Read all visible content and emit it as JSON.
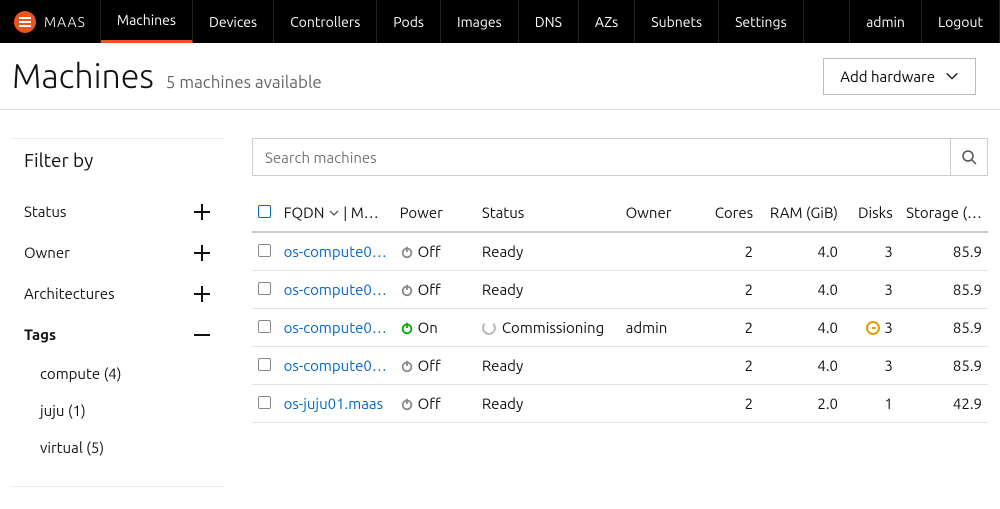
{
  "brand": "MAAS",
  "nav": {
    "items": [
      "Machines",
      "Devices",
      "Controllers",
      "Pods",
      "Images",
      "DNS",
      "AZs",
      "Subnets",
      "Settings"
    ],
    "right": [
      "admin",
      "Logout"
    ],
    "active_index": 0
  },
  "header": {
    "title": "Machines",
    "subtitle": "5 machines available",
    "add_button": "Add hardware"
  },
  "sidebar": {
    "title": "Filter by",
    "filters": [
      {
        "label": "Status",
        "expanded": false
      },
      {
        "label": "Owner",
        "expanded": false
      },
      {
        "label": "Architectures",
        "expanded": false
      },
      {
        "label": "Tags",
        "expanded": true,
        "items": [
          "compute (4)",
          "juju (1)",
          "virtual (5)"
        ]
      }
    ]
  },
  "search": {
    "placeholder": "Search machines"
  },
  "table": {
    "columns": [
      "",
      "FQDN ⌄ | M…",
      "Power",
      "Status",
      "Owner",
      "Cores",
      "RAM (GiB)",
      "Disks",
      "Storage (…"
    ],
    "rows": [
      {
        "fqdn": "os-compute0…",
        "power": "Off",
        "power_on": false,
        "status": "Ready",
        "busy": false,
        "owner": "",
        "cores": "2",
        "ram": "4.0",
        "disks": "3",
        "disks_warn": false,
        "storage": "85.9"
      },
      {
        "fqdn": "os-compute0…",
        "power": "Off",
        "power_on": false,
        "status": "Ready",
        "busy": false,
        "owner": "",
        "cores": "2",
        "ram": "4.0",
        "disks": "3",
        "disks_warn": false,
        "storage": "85.9"
      },
      {
        "fqdn": "os-compute0…",
        "power": "On",
        "power_on": true,
        "status": "Commissioning",
        "busy": true,
        "owner": "admin",
        "cores": "2",
        "ram": "4.0",
        "disks": "3",
        "disks_warn": true,
        "storage": "85.9"
      },
      {
        "fqdn": "os-compute0…",
        "power": "Off",
        "power_on": false,
        "status": "Ready",
        "busy": false,
        "owner": "",
        "cores": "2",
        "ram": "4.0",
        "disks": "3",
        "disks_warn": false,
        "storage": "85.9"
      },
      {
        "fqdn": "os-juju01.maas",
        "power": "Off",
        "power_on": false,
        "status": "Ready",
        "busy": false,
        "owner": "",
        "cores": "2",
        "ram": "2.0",
        "disks": "1",
        "disks_warn": false,
        "storage": "42.9"
      }
    ]
  }
}
